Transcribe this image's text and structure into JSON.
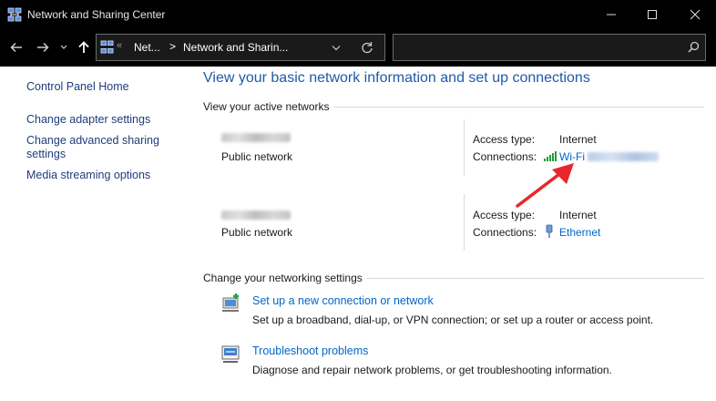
{
  "window": {
    "title": "Network and Sharing Center"
  },
  "address": {
    "crumb_prefix": "«",
    "crumb1": "Net...",
    "crumb_sep": ">",
    "crumb2": "Network and Sharin..."
  },
  "search": {
    "placeholder": ""
  },
  "sidebar": {
    "items": [
      {
        "label": "Control Panel Home"
      },
      {
        "label": "Change adapter settings"
      },
      {
        "label": "Change advanced sharing settings"
      },
      {
        "label": "Media streaming options"
      }
    ]
  },
  "main": {
    "heading": "View your basic network information and set up connections",
    "active_networks_label": "View your active networks",
    "networks": [
      {
        "type": "Public network",
        "access_label": "Access type:",
        "access_value": "Internet",
        "connections_label": "Connections:",
        "connection_name": "Wi-Fi",
        "connection_icon": "wifi-signal-icon"
      },
      {
        "type": "Public network",
        "access_label": "Access type:",
        "access_value": "Internet",
        "connections_label": "Connections:",
        "connection_name": "Ethernet",
        "connection_icon": "ethernet-plug-icon"
      }
    ],
    "change_settings_label": "Change your networking settings",
    "tasks": [
      {
        "title": "Set up a new connection or network",
        "desc": "Set up a broadband, dial-up, or VPN connection; or set up a router or access point.",
        "icon": "new-connection-icon"
      },
      {
        "title": "Troubleshoot problems",
        "desc": "Diagnose and repair network problems, or get troubleshooting information.",
        "icon": "troubleshoot-icon"
      }
    ]
  },
  "colors": {
    "link": "#0066cc",
    "heading": "#1e5aa8",
    "titlebar": "#000000",
    "annotation_arrow": "#e8262b"
  }
}
